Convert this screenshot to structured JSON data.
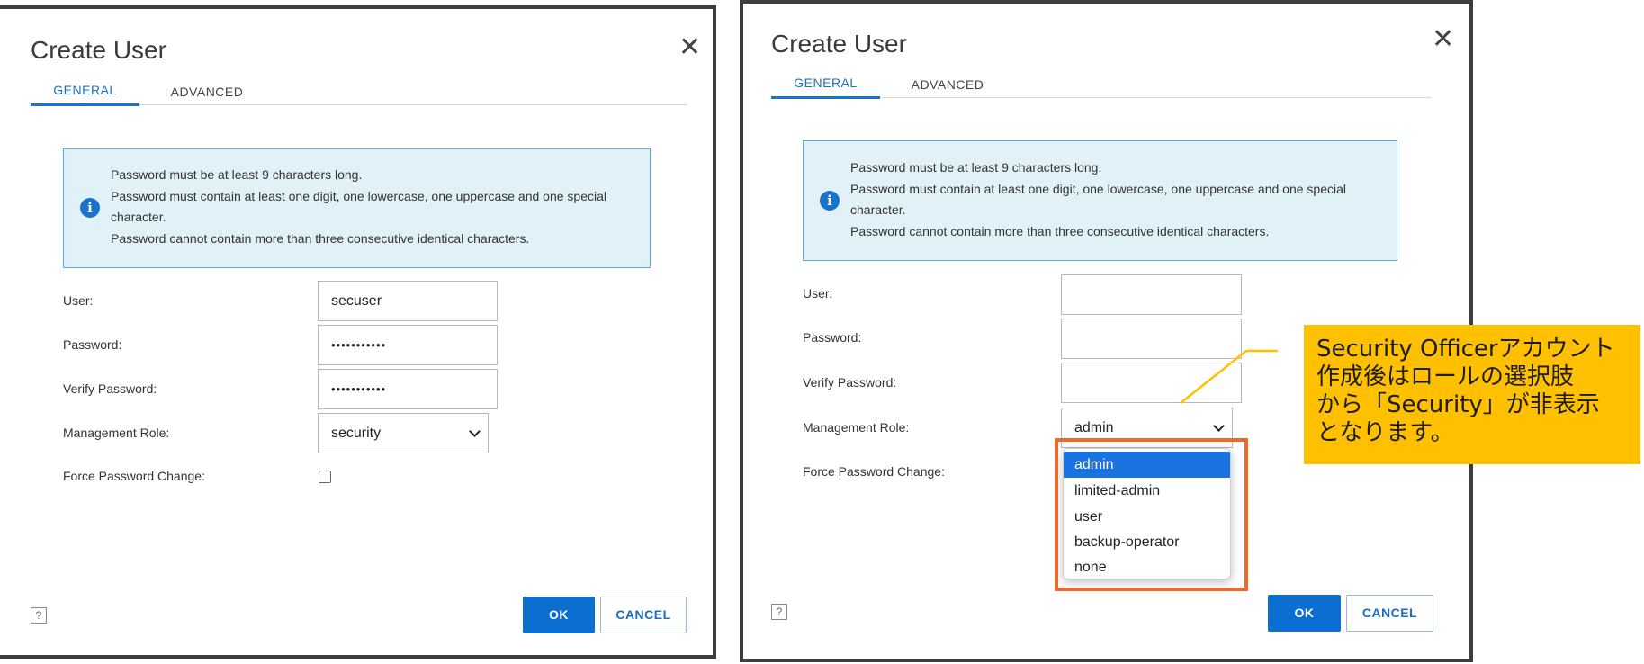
{
  "left_dialog": {
    "title": "Create User",
    "tabs": [
      {
        "label": "GENERAL"
      },
      {
        "label": "ADVANCED"
      }
    ],
    "info": [
      "Password must be at least 9 characters long.",
      "Password must contain at least one digit, one lowercase, one uppercase and one special",
      "character.",
      "Password cannot contain more than three consecutive identical characters."
    ],
    "fields": {
      "user_label": "User:",
      "user_value": "secuser",
      "password_label": "Password:",
      "password_value": "•••••••••••",
      "verify_label": "Verify Password:",
      "verify_value": "•••••••••••",
      "role_label": "Management Role:",
      "role_value": "security",
      "force_label": "Force Password Change:"
    },
    "help_label": "?",
    "ok_label": "OK",
    "cancel_label": "CANCEL"
  },
  "right_dialog": {
    "title": "Create User",
    "tabs": [
      {
        "label": "GENERAL"
      },
      {
        "label": "ADVANCED"
      }
    ],
    "info": [
      "Password must be at least 9 characters long.",
      "Password must contain at least one digit, one lowercase, one uppercase and one special",
      "character.",
      "Password cannot contain more than three consecutive identical characters."
    ],
    "fields": {
      "user_label": "User:",
      "user_value": "",
      "password_label": "Password:",
      "password_value": "",
      "verify_label": "Verify Password:",
      "verify_value": "",
      "role_label": "Management Role:",
      "role_value": "admin",
      "force_label": "Force Password Change:"
    },
    "role_options": [
      "admin",
      "limited-admin",
      "user",
      "backup-operator",
      "none"
    ],
    "help_label": "?",
    "ok_label": "OK",
    "cancel_label": "CANCEL"
  },
  "callout": {
    "lines": [
      "Security Officerアカウント",
      "作成後はロールの選択肢",
      "から「Security」が非表示",
      "となります。"
    ]
  },
  "colors": {
    "accent": "#1a73c8",
    "highlight": "#ea6b2c",
    "callout_bg": "#ffc000",
    "info_bg": "#e1f1f8"
  },
  "icons": [
    "close-icon",
    "info-icon",
    "chevron-down-icon",
    "help-icon"
  ]
}
